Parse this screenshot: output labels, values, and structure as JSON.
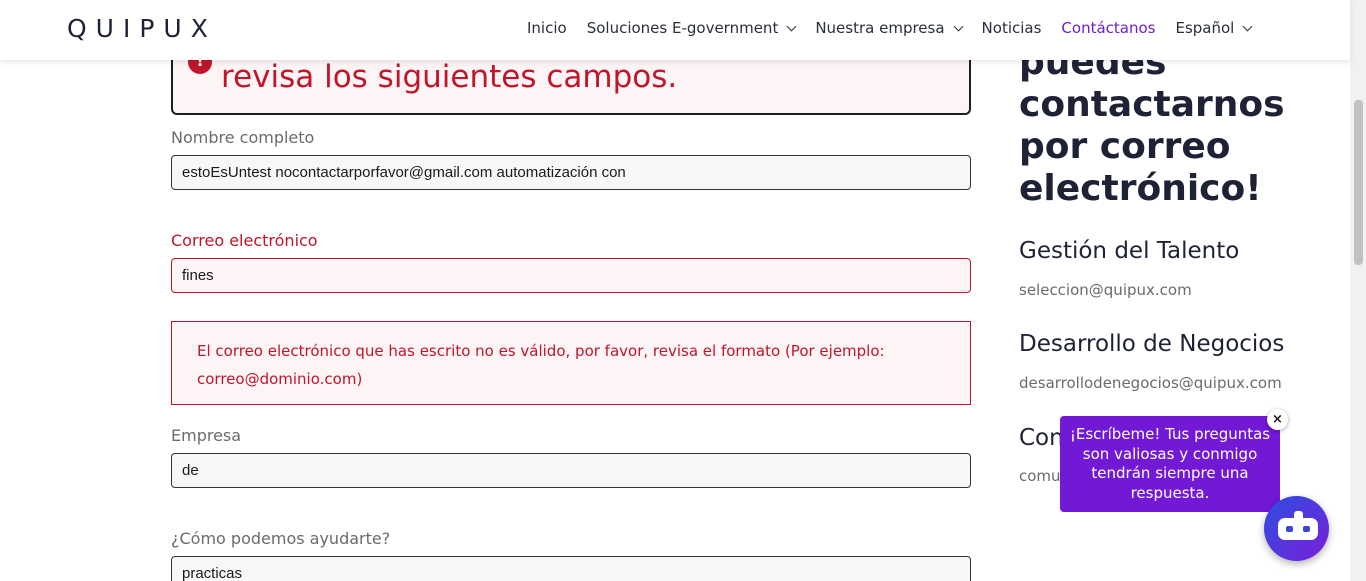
{
  "header": {
    "logo": "QUIPU",
    "logo_x": "X",
    "nav": [
      {
        "label": "Inicio"
      },
      {
        "label": "Soluciones E-government"
      },
      {
        "label": "Nuestra empresa"
      },
      {
        "label": "Noticias"
      },
      {
        "label": "Contáctanos"
      },
      {
        "label": "Español"
      }
    ]
  },
  "error_banner": {
    "icon": "!",
    "text": "revisa los siguientes campos."
  },
  "form": {
    "name": {
      "label": "Nombre completo",
      "value": "estoEsUntest nocontactarporfavor@gmail.com automatización con"
    },
    "email": {
      "label": "Correo electrónico",
      "value": "fines"
    },
    "email_error": {
      "line1": "El correo electrónico que has escrito no es válido, por favor, revisa el formato (Por ejemplo:",
      "line2": "correo@dominio.com)"
    },
    "company": {
      "label": "Empresa",
      "value": "de"
    },
    "help": {
      "label": "¿Cómo podemos ayudarte?",
      "value": "practicas"
    }
  },
  "side": {
    "title_lines": [
      "puedes",
      "contactarnos",
      "por correo",
      "electrónico!"
    ],
    "sections": [
      {
        "heading": "Gestión del Talento",
        "email": "seleccion@quipux.com"
      },
      {
        "heading": "Desarrollo de Negocios",
        "email": "desarrollodenegocios@quipux.com"
      },
      {
        "heading": "Con",
        "email": "comu"
      }
    ]
  },
  "chat": {
    "message": "¡Escríbeme! Tus preguntas son valiosas y conmigo tendrán siempre una respuesta.",
    "close": "×"
  },
  "colors": {
    "accent": "#6b1fd1",
    "error": "#c0152b",
    "chat_bg": "#7219d6"
  }
}
